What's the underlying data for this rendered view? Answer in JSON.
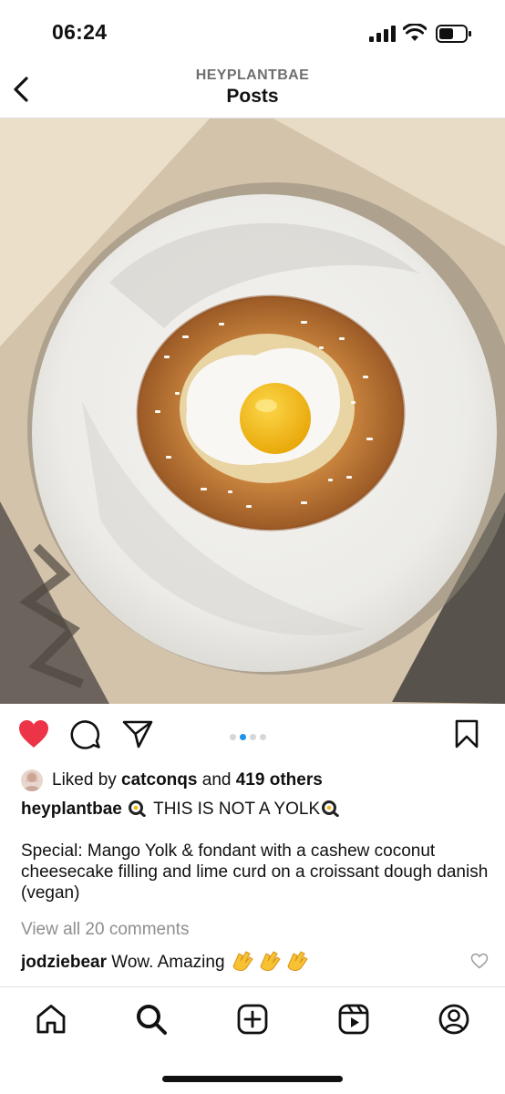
{
  "status_bar": {
    "time": "06:24"
  },
  "header": {
    "username": "HEYPLANTBAE",
    "title": "Posts"
  },
  "post": {
    "carousel": {
      "total": 4,
      "active": 1
    },
    "liked_by_prefix": "Liked by ",
    "liked_by_user": "catconqs",
    "liked_by_and": " and ",
    "liked_by_others": "419 others",
    "author": "heyplantbae",
    "caption_headline": "THIS IS NOT A YOLK",
    "caption_body": "Special: Mango Yolk & fondant with a cashew coconut cheesecake filling and lime curd on a croissant dough danish (vegan)",
    "view_comments": "View all 20 comments",
    "comments": [
      {
        "user": "jodziebear",
        "text": "Wow. Amazing"
      }
    ]
  },
  "icons": {
    "back": "chevron-left-icon",
    "like": "heart-icon",
    "comment": "speech-bubble-icon",
    "share": "paper-plane-icon",
    "save": "bookmark-icon",
    "nav": [
      "home-icon",
      "search-icon",
      "create-post-icon",
      "reels-icon",
      "profile-icon"
    ]
  },
  "colors": {
    "like_red": "#ed3347",
    "carousel_active": "#1d91e8",
    "muted_text": "#8e8e8e"
  }
}
